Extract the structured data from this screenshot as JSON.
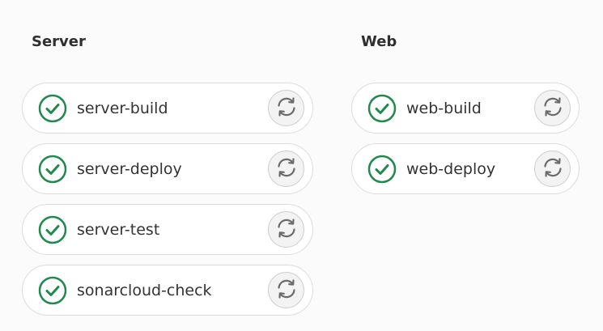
{
  "colors": {
    "success": "#1f8a4c",
    "retry_icon": "#6b6b6b"
  },
  "stages": [
    {
      "title": "Server",
      "jobs": [
        {
          "name": "server-build",
          "status": "success",
          "status_icon": "check-circle-icon",
          "action_icon": "retry-icon"
        },
        {
          "name": "server-deploy",
          "status": "success",
          "status_icon": "check-circle-icon",
          "action_icon": "retry-icon"
        },
        {
          "name": "server-test",
          "status": "success",
          "status_icon": "check-circle-icon",
          "action_icon": "retry-icon"
        },
        {
          "name": "sonarcloud-check",
          "status": "success",
          "status_icon": "check-circle-icon",
          "action_icon": "retry-icon"
        }
      ]
    },
    {
      "title": "Web",
      "jobs": [
        {
          "name": "web-build",
          "status": "success",
          "status_icon": "check-circle-icon",
          "action_icon": "retry-icon"
        },
        {
          "name": "web-deploy",
          "status": "success",
          "status_icon": "check-circle-icon",
          "action_icon": "retry-icon"
        }
      ]
    }
  ]
}
